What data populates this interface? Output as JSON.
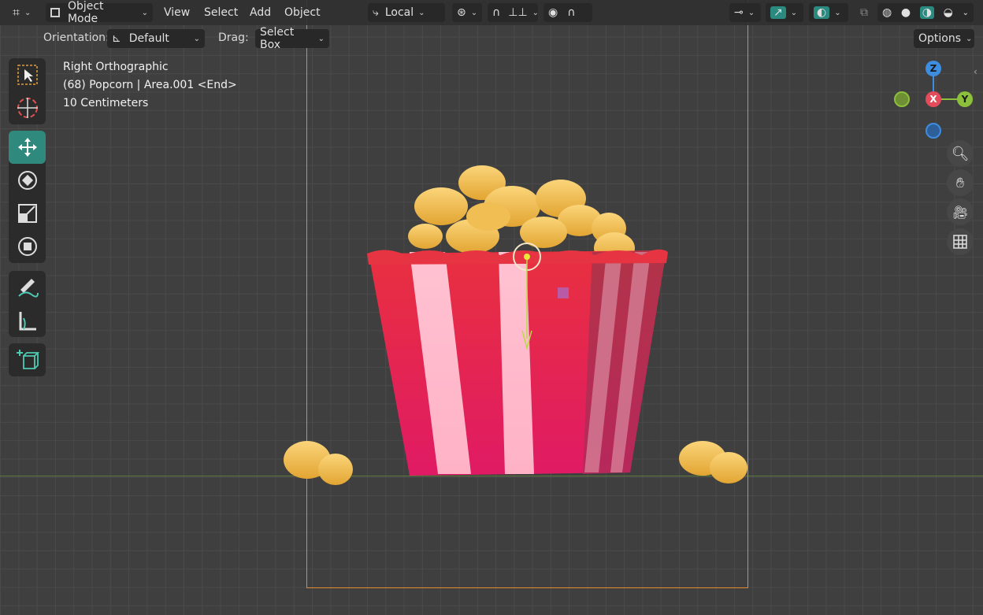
{
  "header": {
    "mode": "Object Mode",
    "menus": [
      "View",
      "Select",
      "Add",
      "Object"
    ],
    "transform_orientation": "Local",
    "options_label": "Options"
  },
  "subheader": {
    "orientation_label": "Orientation:",
    "orientation_value": "Default",
    "drag_label": "Drag:",
    "drag_value": "Select Box"
  },
  "overlay": {
    "view_name": "Right Orthographic",
    "object_info": "(68) Popcorn | Area.001 <End>",
    "grid_scale": "10 Centimeters"
  },
  "gizmo": {
    "z": "Z",
    "x": "X",
    "y": "Y"
  },
  "colors": {
    "accent": "#2f8a7d",
    "frame": "#e38a2f",
    "axis_x": "#e34a5a",
    "axis_y": "#8cbf3a",
    "axis_z": "#3d8ee0"
  }
}
